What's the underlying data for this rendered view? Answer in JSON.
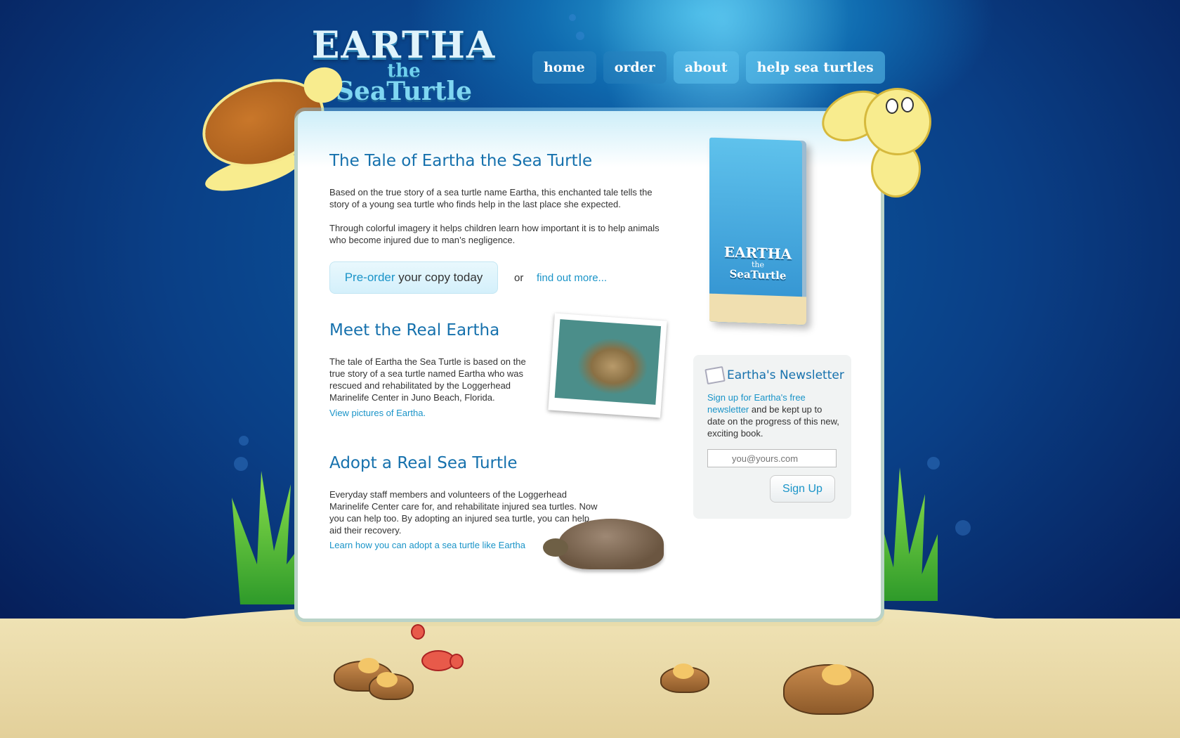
{
  "brand": {
    "logo_line1": "EARTHA",
    "logo_line2": "the",
    "logo_line3": "SeaTurtle"
  },
  "nav": {
    "home": "home",
    "order": "order",
    "about": "about",
    "help": "help sea turtles"
  },
  "tale": {
    "heading": "The Tale of Eartha the Sea Turtle",
    "para1": "Based on the true story of a sea turtle name Eartha, this enchanted tale tells the story of a young sea turtle who finds help in the last place she expected.",
    "para2": "Through colorful imagery it helps children learn how important it is to help animals who become injured due to man’s negligence.",
    "preorder_link": "Pre-order",
    "preorder_rest": " your copy today",
    "or": "or",
    "find_more": "find out more..."
  },
  "book": {
    "title1": "EARTHA",
    "title2": "the",
    "title3": "SeaTurtle"
  },
  "meet": {
    "heading": "Meet the Real Eartha",
    "para": "The tale of Eartha the Sea Turtle is based on the true story of a sea turtle named Eartha who was rescued and rehabilitated by the Loggerhead Marinelife Center in Juno Beach, Florida.",
    "link": "View pictures of Eartha."
  },
  "adopt": {
    "heading": "Adopt a Real Sea Turtle",
    "para": "Everyday staff members and volunteers of the Loggerhead Marinelife Center care for, and rehabilitate injured sea turtles. Now you can help too. By adopting an injured sea turtle, you can help aid their recovery.",
    "link": "Learn how you can adopt a sea turtle like Eartha"
  },
  "newsletter": {
    "title": "Eartha's Newsletter",
    "signup_link": "Sign up for Eartha's free newsletter",
    "body": " and be kept up to date on the progress of this new, exciting book.",
    "email_placeholder": "you@yours.com",
    "button": "Sign Up"
  },
  "colors": {
    "link": "#1a94c8",
    "heading": "#1671ad",
    "ocean": "#0a3f86",
    "sand": "#efe2b4"
  }
}
